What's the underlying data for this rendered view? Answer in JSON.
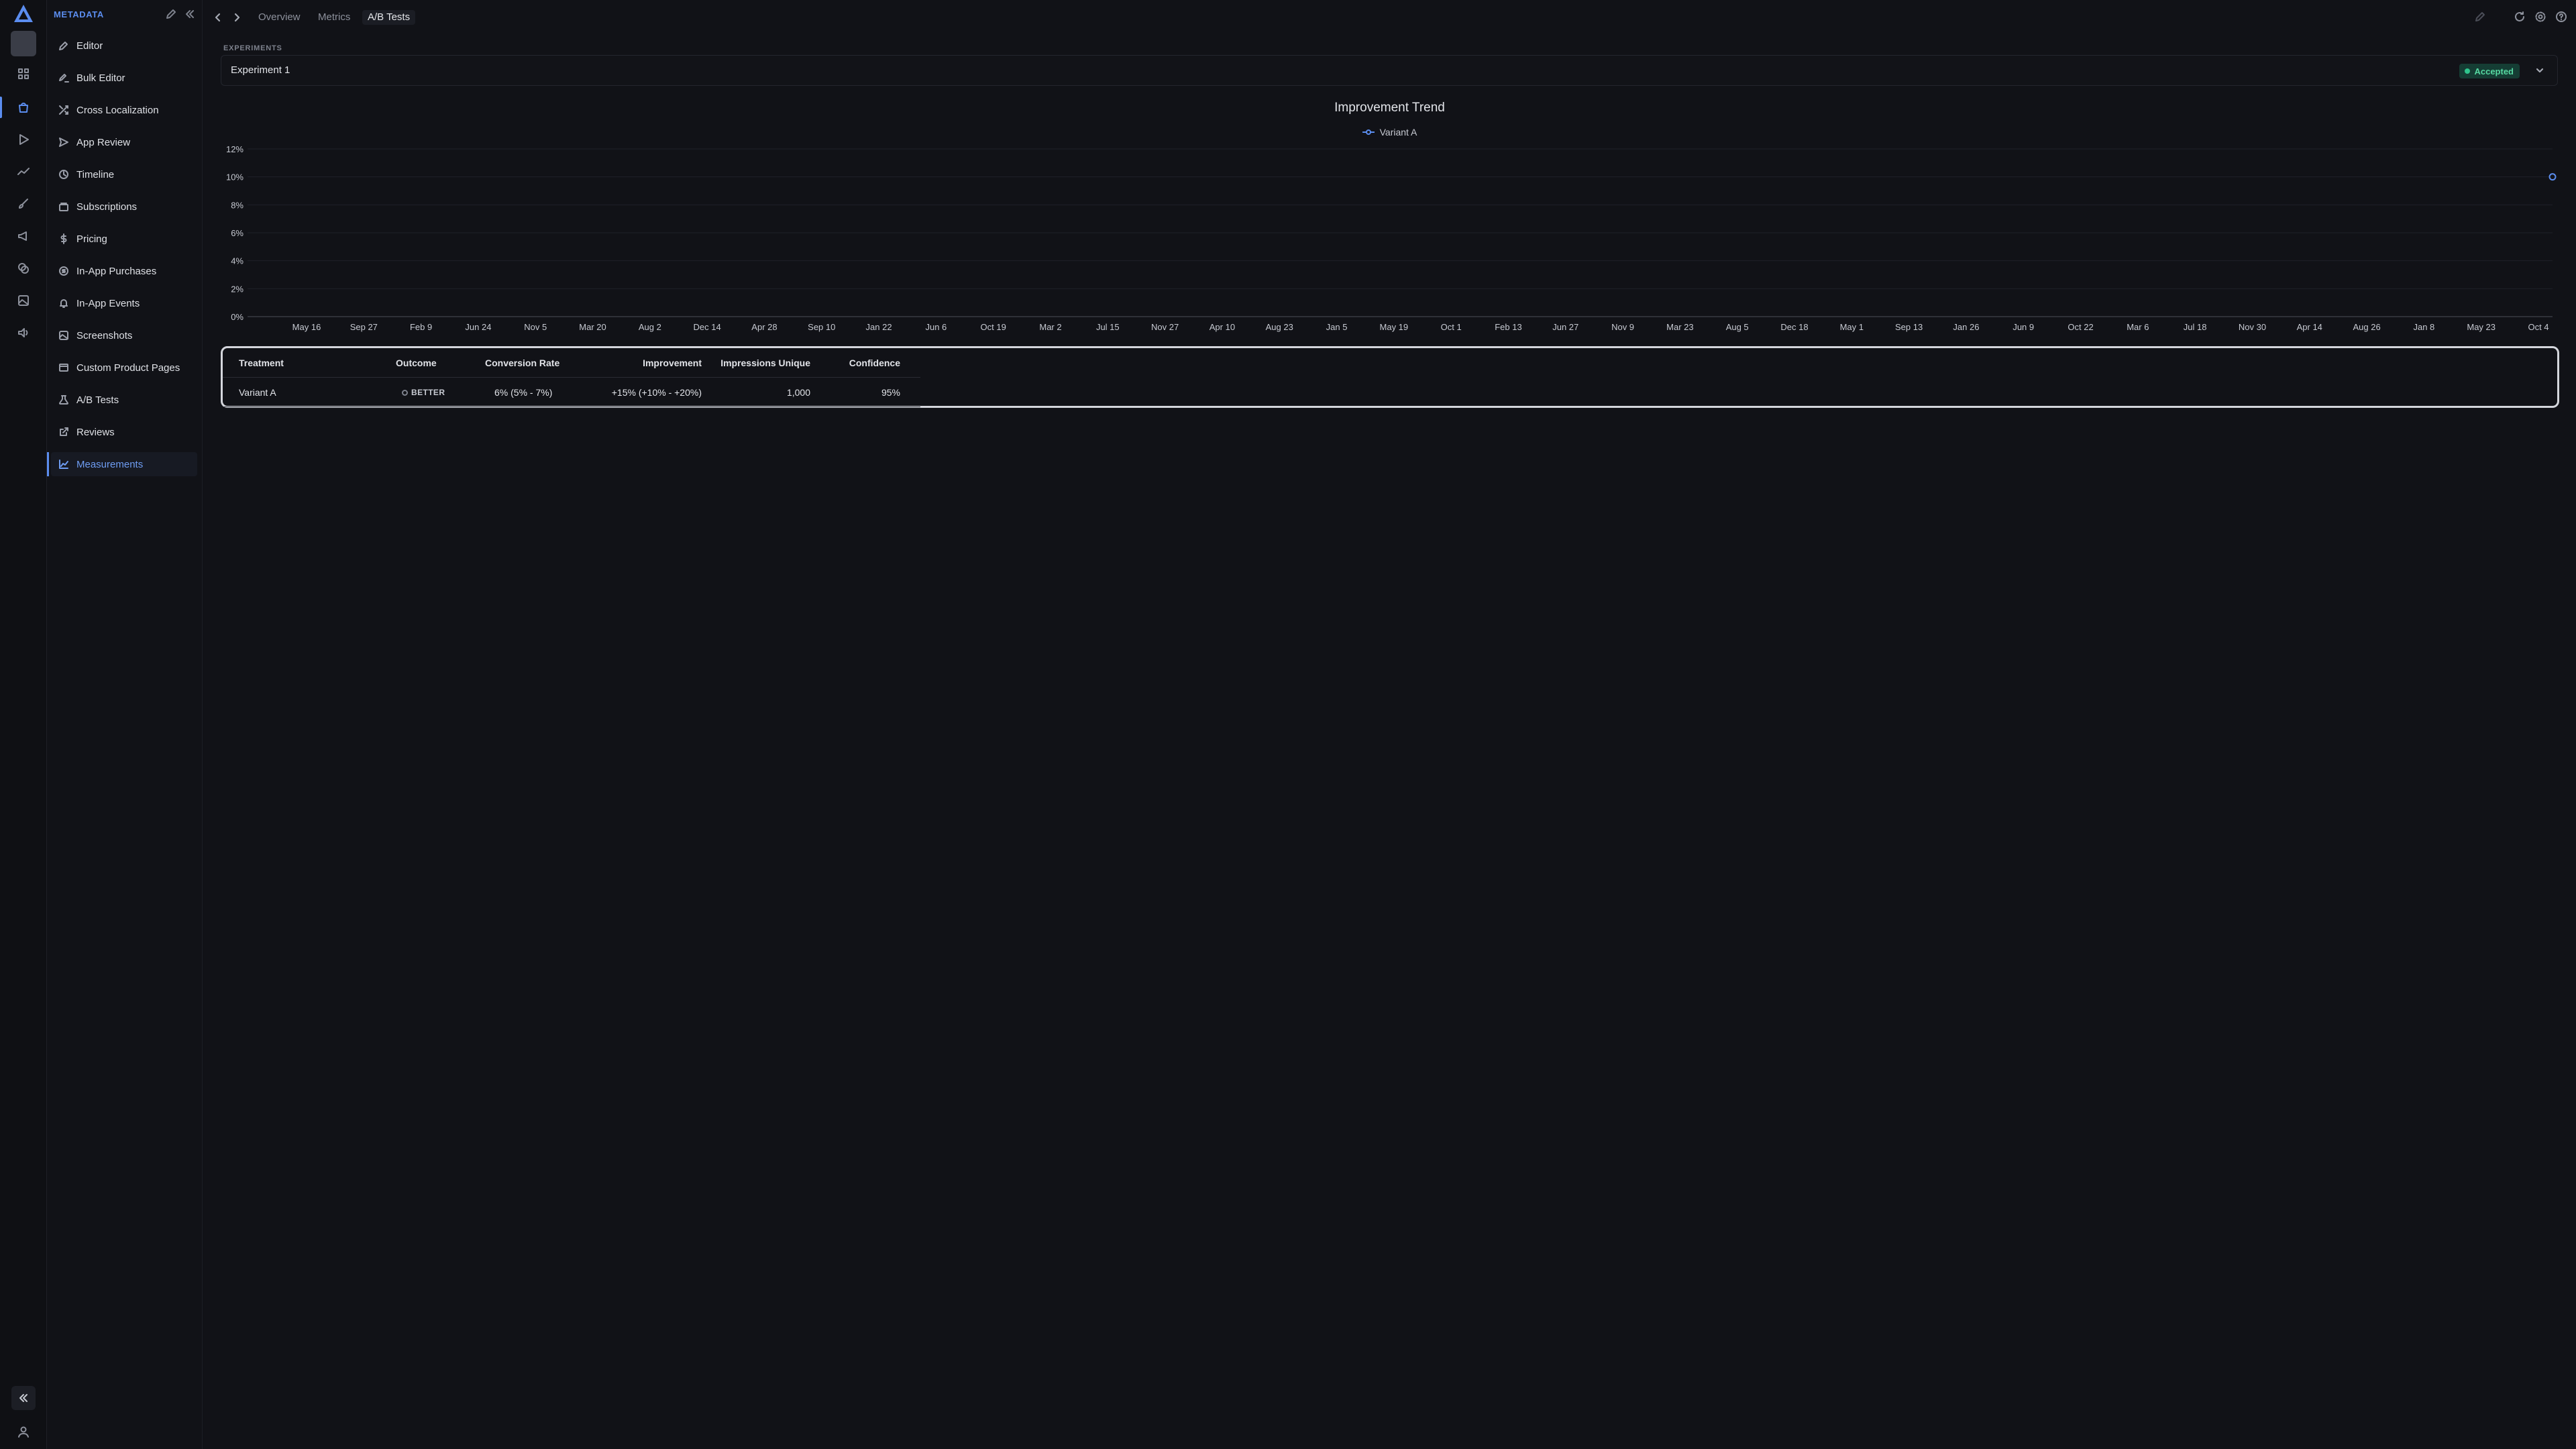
{
  "sidebar": {
    "section_title": "METADATA",
    "items": [
      {
        "label": "Editor",
        "icon": "pencil-icon"
      },
      {
        "label": "Bulk Editor",
        "icon": "bulk-edit-icon"
      },
      {
        "label": "Cross Localization",
        "icon": "shuffle-icon"
      },
      {
        "label": "App Review",
        "icon": "send-icon"
      },
      {
        "label": "Timeline",
        "icon": "clock-icon"
      },
      {
        "label": "Subscriptions",
        "icon": "subscriptions-icon"
      },
      {
        "label": "Pricing",
        "icon": "dollar-icon"
      },
      {
        "label": "In-App Purchases",
        "icon": "coin-icon"
      },
      {
        "label": "In-App Events",
        "icon": "bell-icon"
      },
      {
        "label": "Screenshots",
        "icon": "image-icon"
      },
      {
        "label": "Custom Product Pages",
        "icon": "pages-icon"
      },
      {
        "label": "A/B Tests",
        "icon": "flask-icon"
      },
      {
        "label": "Reviews",
        "icon": "external-link-icon"
      },
      {
        "label": "Measurements",
        "icon": "line-chart-icon",
        "active": true
      }
    ]
  },
  "topbar": {
    "tabs": [
      {
        "label": "Overview"
      },
      {
        "label": "Metrics"
      },
      {
        "label": "A/B Tests",
        "active": true
      }
    ]
  },
  "experiments": {
    "label": "EXPERIMENTS",
    "selected": "Experiment 1",
    "status": "Accepted",
    "status_color": "#2fc58d"
  },
  "chart_data": {
    "type": "line",
    "title": "Improvement Trend",
    "series": [
      {
        "name": "Variant A",
        "color": "#5b8def",
        "points": [
          {
            "x": "Oct 4",
            "y": 10
          }
        ]
      }
    ],
    "y_ticks": [
      "0%",
      "2%",
      "4%",
      "6%",
      "8%",
      "10%",
      "12%"
    ],
    "ylim": [
      0,
      12
    ],
    "x_ticks": [
      "May 16",
      "Sep 27",
      "Feb 9",
      "Jun 24",
      "Nov 5",
      "Mar 20",
      "Aug 2",
      "Dec 14",
      "Apr 28",
      "Sep 10",
      "Jan 22",
      "Jun 6",
      "Oct 19",
      "Mar 2",
      "Jul 15",
      "Nov 27",
      "Apr 10",
      "Aug 23",
      "Jan 5",
      "May 19",
      "Oct 1",
      "Feb 13",
      "Jun 27",
      "Nov 9",
      "Mar 23",
      "Aug 5",
      "Dec 18",
      "May 1",
      "Sep 13",
      "Jan 26",
      "Jun 9",
      "Oct 22",
      "Mar 6",
      "Jul 18",
      "Nov 30",
      "Apr 14",
      "Aug 26",
      "Jan 8",
      "May 23",
      "Oct 4"
    ],
    "grid": true,
    "legend": "top-center"
  },
  "results": {
    "headers": {
      "treatment": "Treatment",
      "outcome": "Outcome",
      "conversion_rate": "Conversion Rate",
      "improvement": "Improvement",
      "impressions": "Impressions Unique",
      "confidence": "Confidence"
    },
    "rows": [
      {
        "treatment": "Variant A",
        "outcome": "BETTER",
        "conversion_rate": "6% (5% - 7%)",
        "improvement": "+15% (+10% - +20%)",
        "impressions": "1,000",
        "confidence": "95%"
      }
    ]
  }
}
